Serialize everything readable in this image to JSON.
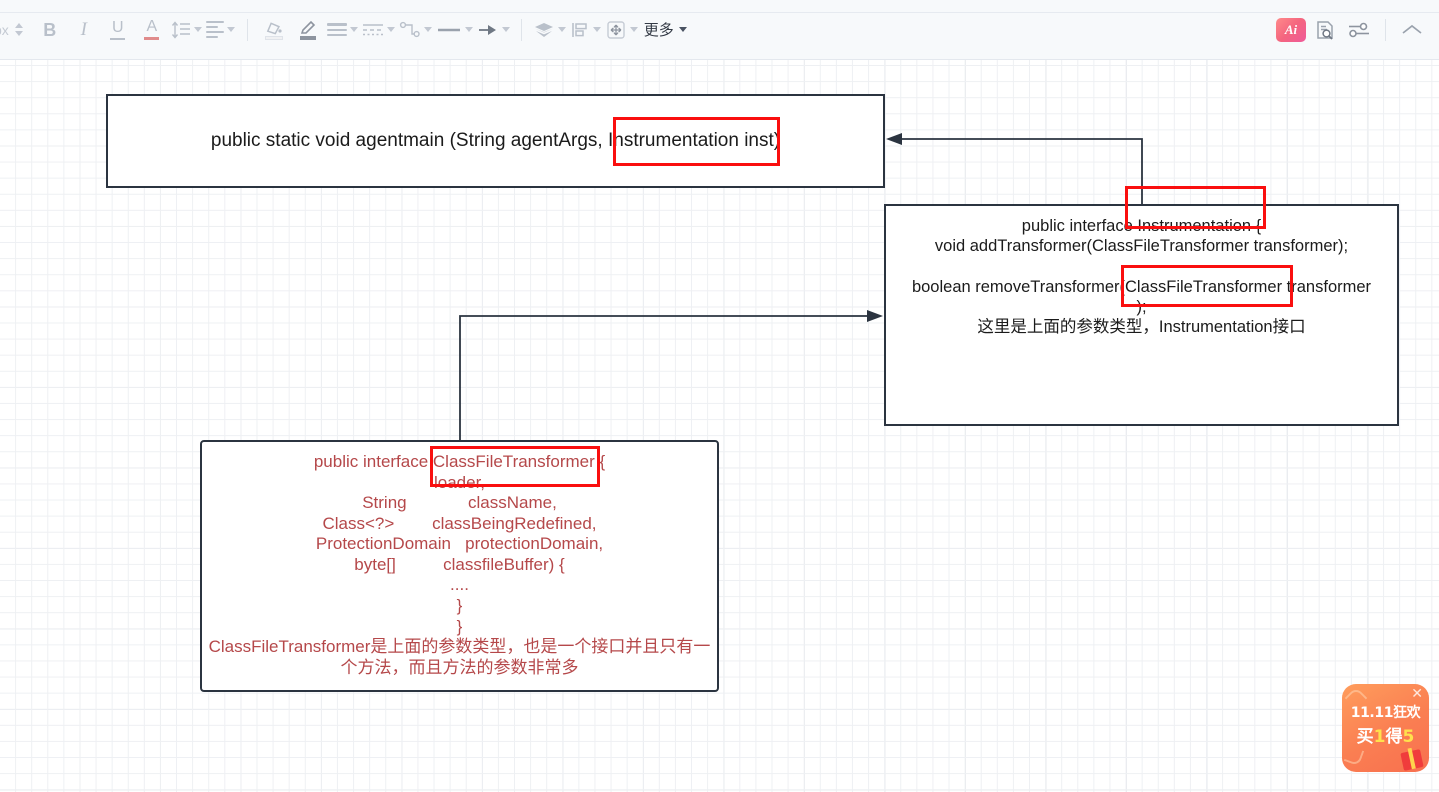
{
  "toolbar": {
    "font_size_unit": "px",
    "more_label": "更多",
    "items": [
      {
        "name": "bold",
        "glyph": "B"
      },
      {
        "name": "italic",
        "glyph": "I"
      },
      {
        "name": "underline",
        "glyph": "U"
      },
      {
        "name": "font-color",
        "glyph": "A"
      },
      {
        "name": "line-height",
        "glyph": "line-spacing"
      },
      {
        "name": "text-align",
        "glyph": "align"
      },
      {
        "name": "fill-color",
        "glyph": "paint-bucket"
      },
      {
        "name": "pen-color",
        "glyph": "pen"
      },
      {
        "name": "border-width",
        "glyph": "border-lines"
      },
      {
        "name": "border-style",
        "glyph": "dashed-lines"
      },
      {
        "name": "connector-style",
        "glyph": "connector"
      },
      {
        "name": "line-style",
        "glyph": "line"
      },
      {
        "name": "arrow-style",
        "glyph": "arrow"
      },
      {
        "name": "layer-order",
        "glyph": "layers"
      },
      {
        "name": "align-objects",
        "glyph": "align-objects"
      },
      {
        "name": "position",
        "glyph": "move"
      }
    ],
    "ai_label": "Ai"
  },
  "diagram": {
    "nodes": [
      {
        "id": "agentmain",
        "text": "public static void agentmain (String agentArgs, Instrumentation inst)",
        "text_color": "#1b1b1b",
        "border_color": "#2b3440"
      },
      {
        "id": "instrumentation",
        "text": "public interface Instrumentation {\nvoid addTransformer(ClassFileTransformer transformer);\n\nboolean removeTransformer(ClassFileTransformer transformer\n);\n这里是上面的参数类型，Instrumentation接口",
        "text_color": "#1b1b1b",
        "border_color": "#2b3440"
      },
      {
        "id": "classfiletransformer",
        "text": "public interface ClassFileTransformer {\nloader,\nString             className,\nClass<?>        classBeingRedefined,\nProtectionDomain   protectionDomain,\nbyte[]          classfileBuffer) {\n....\n}\n}\nClassFileTransformer是上面的参数类型，也是一个接口并且只有一个方法，而且方法的参数非常多",
        "text_color": "#b5484a",
        "border_color": "#2b3440"
      }
    ],
    "highlights": [
      {
        "id": "hl-instrumentation-param",
        "label": "Instrumentation",
        "color": "#fa0f0f"
      },
      {
        "id": "hl-instrumentation-iface",
        "label": "Instrumentation",
        "color": "#fa0f0f"
      },
      {
        "id": "hl-cft-param",
        "label": "ClassFileTransformer",
        "color": "#fa0f0f"
      },
      {
        "id": "hl-cft-iface",
        "label": "ClassFileTransformer",
        "color": "#fa0f0f"
      }
    ],
    "connectors": [
      {
        "id": "instrumentation-to-agentmain",
        "from": "instrumentation",
        "to": "agentmain",
        "color": "#2b3440"
      },
      {
        "id": "classfiletransformer-to-instrumentation",
        "from": "classfiletransformer",
        "to": "instrumentation",
        "color": "#2b3440"
      }
    ]
  },
  "promo": {
    "line1": "11.11狂欢",
    "line2_prefix": "买",
    "line2_num1": "1",
    "line2_mid": "得",
    "line2_num2": "5",
    "close": "✕"
  }
}
